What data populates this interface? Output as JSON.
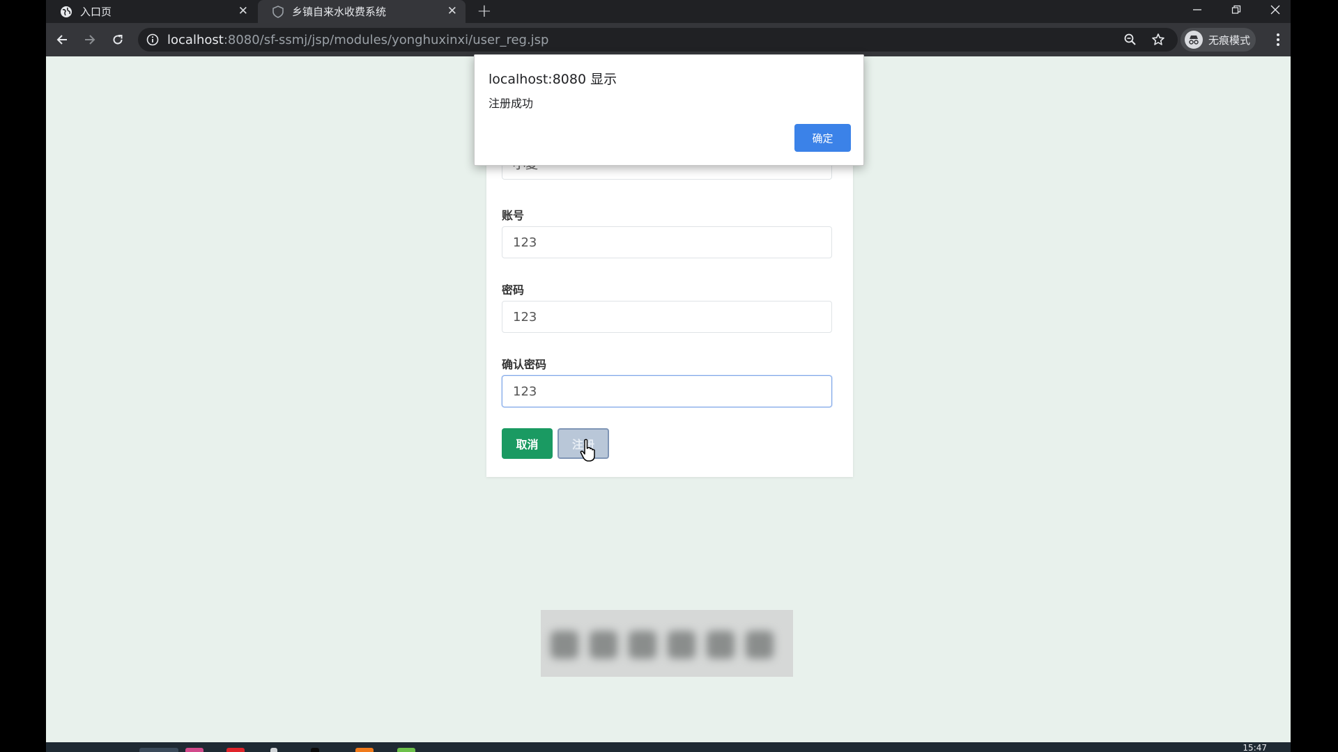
{
  "browser": {
    "tabs": [
      {
        "label": "入口页",
        "icon": "globe-icon"
      },
      {
        "label": "乡镇自来水收费系统",
        "icon": "shield-icon"
      }
    ],
    "url_host": "localhost",
    "url_path": ":8080/sf-ssmj/jsp/modules/yonghuxinxi/user_reg.jsp",
    "profile_label": "无痕模式"
  },
  "form": {
    "partial_value": "小夏",
    "fields": [
      {
        "label": "账号",
        "value": "123"
      },
      {
        "label": "密码",
        "value": "123"
      },
      {
        "label": "确认密码",
        "value": "123"
      }
    ],
    "cancel_label": "取消",
    "register_label": "注册"
  },
  "dialog": {
    "title": "localhost:8080 显示",
    "message": "注册成功",
    "ok_label": "确定"
  },
  "taskbar": {
    "time": "15:47"
  },
  "colors": {
    "page_bg": "#e8f1ec",
    "accent_green": "#1a9a62",
    "dialog_button": "#3b82e8"
  }
}
